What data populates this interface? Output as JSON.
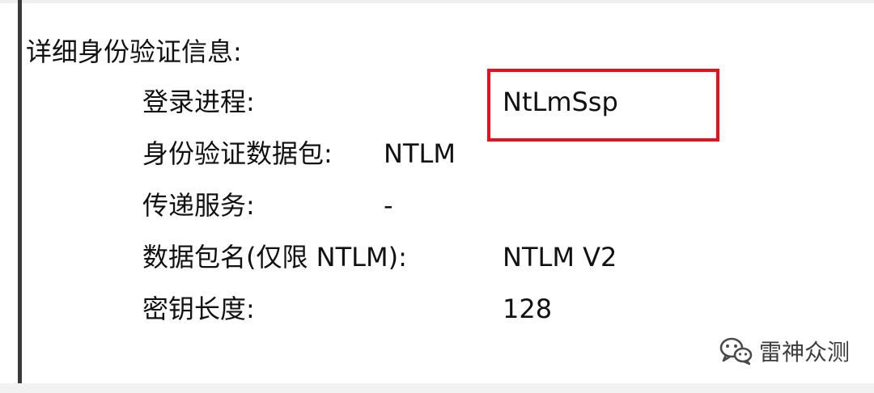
{
  "section": {
    "title": "详细身份验证信息:"
  },
  "rows": [
    {
      "label": "登录进程:",
      "value": "NtLmSsp"
    },
    {
      "label": "身份验证数据包:",
      "value": "NTLM"
    },
    {
      "label": "传递服务:",
      "value": "-"
    },
    {
      "label": "数据包名(仅限 NTLM):",
      "value": "NTLM V2"
    },
    {
      "label": "密钥长度:",
      "value": "128"
    }
  ],
  "highlight": {
    "color": "#e8101f"
  },
  "watermark": {
    "icon": "wechat-icon",
    "text": "雷神众测"
  }
}
